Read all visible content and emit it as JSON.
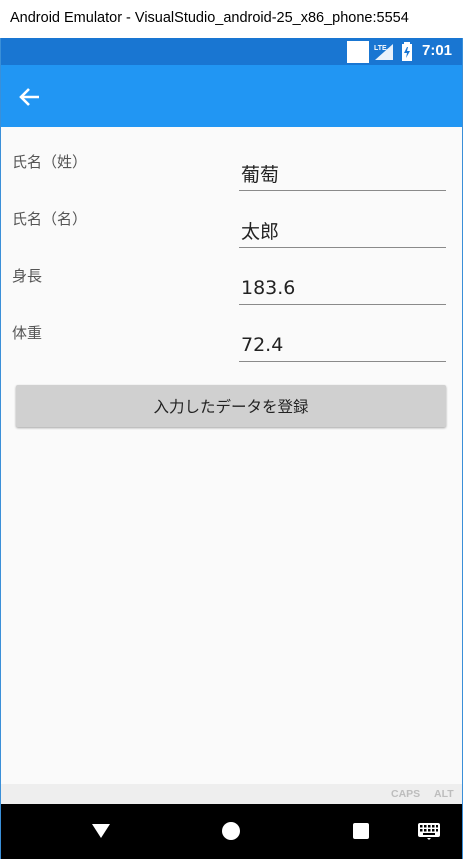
{
  "window": {
    "title": "Android Emulator - VisualStudio_android-25_x86_phone:5554"
  },
  "status_bar": {
    "time": "7:01",
    "network_label": "LTE"
  },
  "app_bar": {
    "back_icon": "arrow-back-icon"
  },
  "form": {
    "fields": [
      {
        "label": "氏名（姓）",
        "value": "葡萄"
      },
      {
        "label": "氏名（名）",
        "value": "太郎"
      },
      {
        "label": "身長",
        "value": "183.6"
      },
      {
        "label": "体重",
        "value": "72.4"
      }
    ],
    "submit_label": "入力したデータを登録"
  },
  "keyboard_indicators": {
    "caps": "CAPS",
    "alt": "ALT"
  },
  "colors": {
    "status_bar": "#1976d2",
    "app_bar": "#2196f3",
    "content_bg": "#fafafa",
    "button_bg": "#d0d0d0",
    "nav_bar": "#000000"
  }
}
